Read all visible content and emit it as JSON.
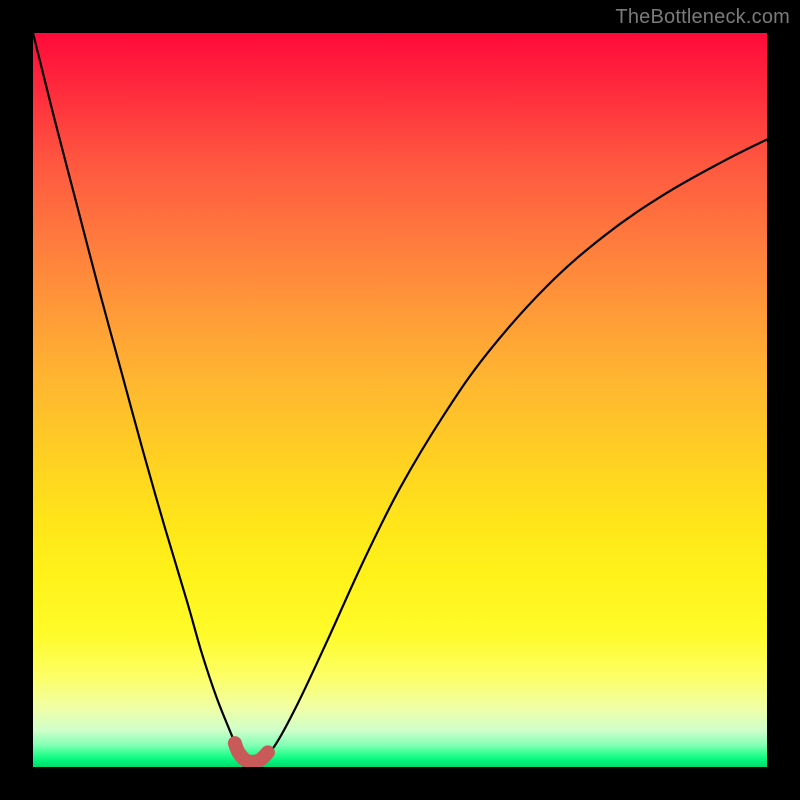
{
  "watermark": {
    "text": "TheBottleneck.com"
  },
  "colors": {
    "background": "#000000",
    "gradient_top": "#ff0a3a",
    "gradient_bottom": "#00d96c",
    "curve": "#000000",
    "curve_thick_stroke": "#c85a5a"
  },
  "chart_data": {
    "type": "line",
    "title": "",
    "xlabel": "",
    "ylabel": "",
    "xlim": [
      0,
      100
    ],
    "ylim": [
      0,
      100
    ],
    "grid": false,
    "legend": false,
    "series": [
      {
        "name": "bottleneck-curve",
        "x": [
          0,
          3,
          6,
          9,
          12,
          15,
          18,
          21,
          23,
          25,
          27,
          28,
          29,
          30,
          31,
          33,
          36,
          40,
          45,
          50,
          56,
          62,
          70,
          78,
          86,
          94,
          100
        ],
        "y": [
          100,
          88,
          76.5,
          65,
          54,
          43,
          32.5,
          22.5,
          15.5,
          9.5,
          4.5,
          2.0,
          0.9,
          0.7,
          1.0,
          3.0,
          8.5,
          17,
          28,
          38,
          48,
          56.5,
          65.5,
          72.5,
          78,
          82.5,
          85.5
        ]
      }
    ],
    "annotations": [
      {
        "name": "minimum-highlight",
        "x_range": [
          27.5,
          32
        ],
        "y_approx": 0.9,
        "stroke": "#c85a5a"
      }
    ]
  }
}
